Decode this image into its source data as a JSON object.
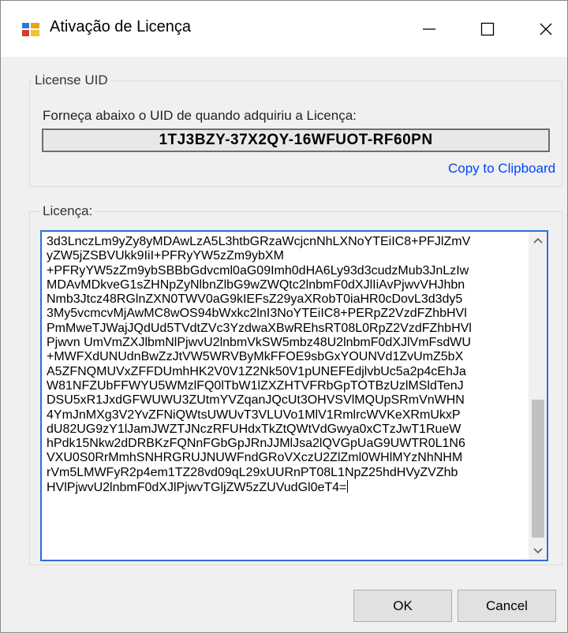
{
  "window": {
    "title": "Ativação de Licença",
    "app_icon": "license-app-icon",
    "controls": {
      "minimize_icon": "minimize-icon",
      "maximize_icon": "maximize-icon",
      "close_icon": "close-icon"
    }
  },
  "license_uid_group": {
    "legend": "License UID",
    "prompt": "Forneça abaixo o UID de quando adquiriu a Licença:",
    "uid_value": "1TJ3BZY-37X2QY-16WFUOT-RF60PN",
    "copy_link": "Copy to Clipboard"
  },
  "license_group": {
    "legend": "Licença:",
    "license_lines": [
      "3d3LnczLm9yZy8yMDAwLzA5L3htbGRzaWcjcnNhLXNoYTEiIC8+PFJlZmV",
      "yZW5jZSBVUkk9IiI+PFRyYW5zZm9ybXM",
      "+PFRyYW5zZm9ybSBBbGdvcml0aG09Imh0dHA6Ly93d3cudzMub3JnLzIw",
      "MDAvMDkveG1sZHNpZyNlbnZlbG9wZWQtc2lnbmF0dXJlIiAvPjwvVHJhbn",
      "Nmb3Jtcz48RGlnZXN0TWV0aG9kIEFsZ29yaXRobT0iaHR0cDovL3d3dy5",
      "3My5vcmcvMjAwMC8wOS94bWxkc2lnI3NoYTEiIC8+PERpZ2VzdFZhbHVl",
      "PmMweTJWajJQdUd5TVdtZVc3YzdwaXBwREhsRT08L0RpZ2VzdFZhbHVl",
      "Pjwvn UmVmZXJlbmNlPjwvU2lnbmVkSW5mbz48U2lnbmF0dXJlVmFsdWU",
      "+MWFXdUNUdnBwZzJtVW5WRVByMkFFOE9sbGxYOUNVd1ZvUmZ5bX",
      "A5ZFNQMUVxZFFDUmhHK2V0V1Z2Nk50V1pUNEFEdjlvbUc5a2p4cEhJa",
      "W81NFZUbFFWYU5WMzlFQ0lTbW1lZXZHTVFRbGpTOTBzUzlMSldTenJ",
      "DSU5xR1JxdGFWUWU3ZUtmYVZqanJQcUt3OHVSVlMQUpSRmVnWHN",
      "4YmJnMXg3V2YvZFNiQWtsUWUvT3VLUVo1MlV1RmlrcWVKeXRmUkxP",
      "dU82UG9zY1lJamJWZTJNczRFUHdxTkZtQWtVdGwya0xCTzJwT1RueW",
      "hPdk15Nkw2dDRBKzFQNnFGbGpJRnJJMlJsa2lQVGpUaG9UWTR0L1N6",
      "VXU0S0RrMmhSNHRGRUJNUWFndGRoVXczU2ZlZml0WHlMYzNhNHM",
      "rVm5LMWFyR2p4em1TZ28vd09qL29xUURnPT08L1NpZ25hdHVyZVZhb",
      "HVlPjwvU2lnbmF0dXJlPjwvTGljZW5zZUVudGl0eT4="
    ],
    "scroll_up_icon": "scroll-up-arrow-icon",
    "scroll_down_icon": "scroll-down-arrow-icon"
  },
  "buttons": {
    "ok": "OK",
    "cancel": "Cancel"
  }
}
